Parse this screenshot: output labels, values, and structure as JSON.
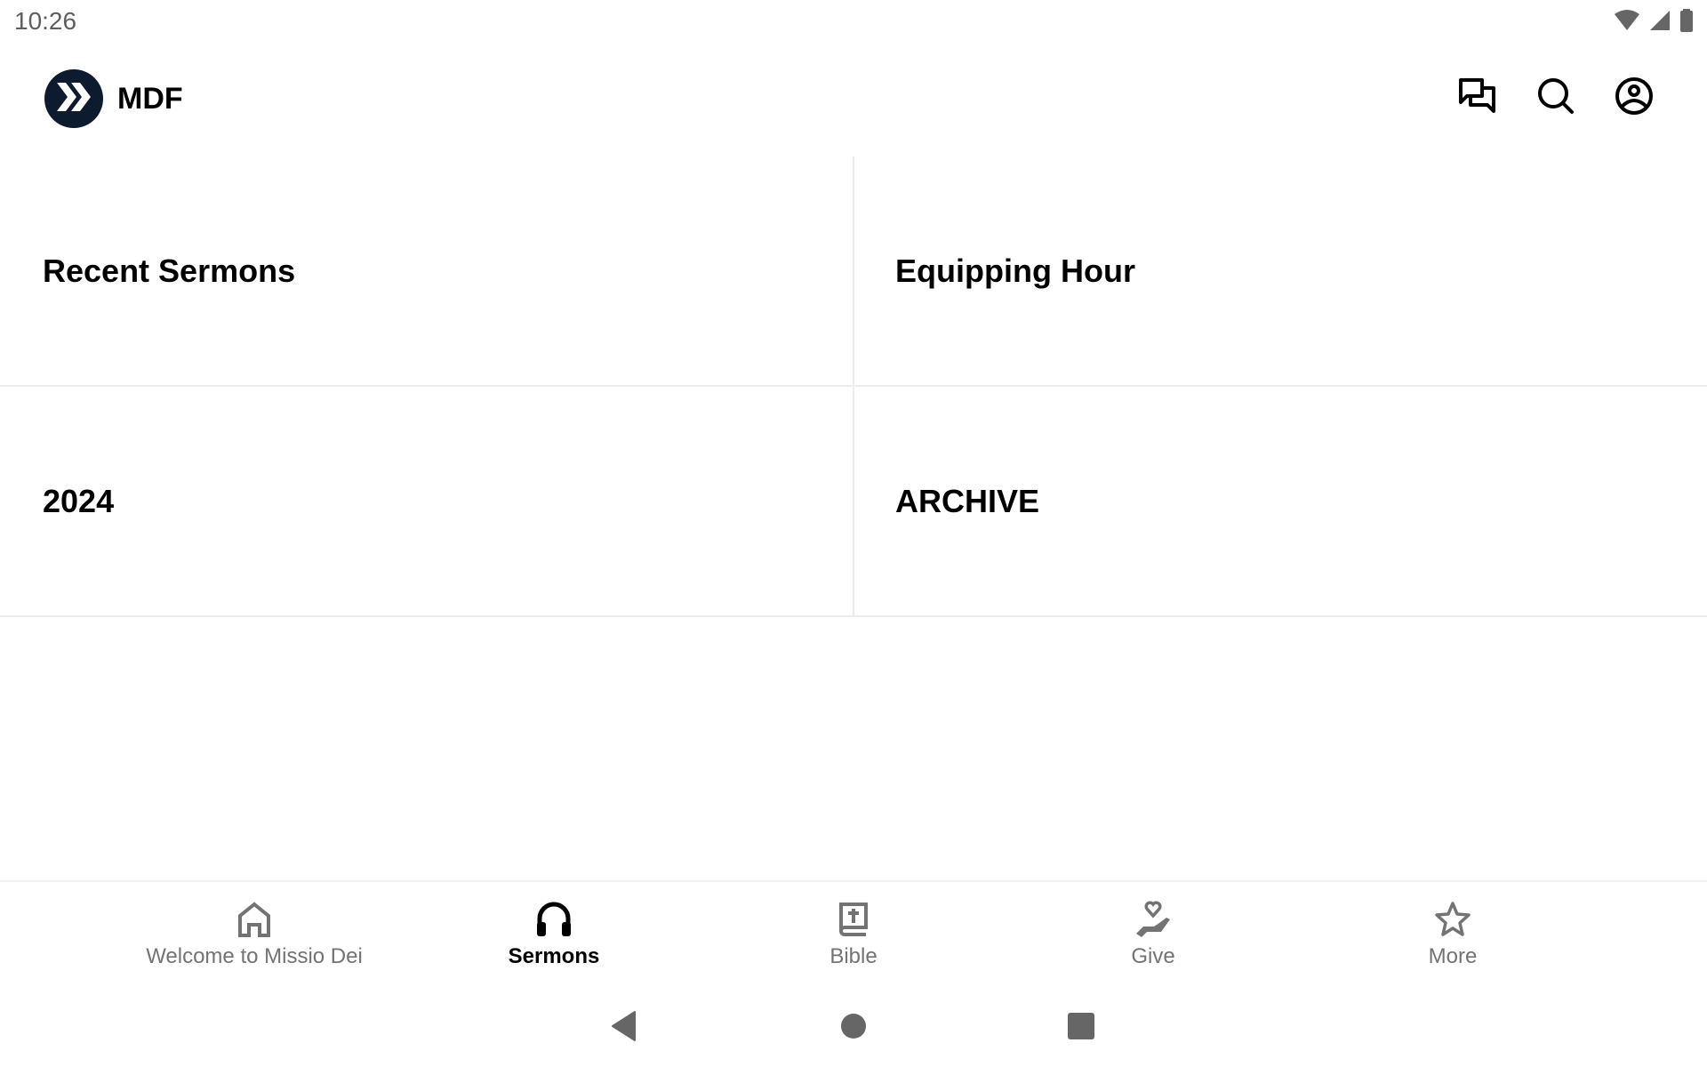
{
  "status_bar": {
    "time": "10:26",
    "icons": [
      "wifi-icon",
      "cellular-signal-icon",
      "battery-icon"
    ]
  },
  "app_bar": {
    "brand": "MDF",
    "logo_icon": "double-chevron-logo",
    "actions": [
      {
        "name": "chat",
        "icon": "chat-bubbles-icon"
      },
      {
        "name": "search",
        "icon": "search-icon"
      },
      {
        "name": "profile",
        "icon": "account-circle-icon"
      }
    ]
  },
  "tiles": [
    {
      "label": "Recent Sermons"
    },
    {
      "label": "Equipping Hour"
    },
    {
      "label": "2024"
    },
    {
      "label": "ARCHIVE"
    }
  ],
  "bottom_nav": {
    "active_index": 1,
    "items": [
      {
        "label": "Welcome to Missio Dei",
        "icon": "home-icon"
      },
      {
        "label": "Sermons",
        "icon": "headphones-icon"
      },
      {
        "label": "Bible",
        "icon": "bible-icon"
      },
      {
        "label": "Give",
        "icon": "give-hand-heart-icon"
      },
      {
        "label": "More",
        "icon": "star-icon"
      }
    ]
  },
  "system_nav": {
    "buttons": [
      "back",
      "home",
      "recents"
    ]
  },
  "colors": {
    "logo_bg": "#0d1b2e",
    "inactive": "#737373",
    "active": "#000000",
    "divider": "#ececec",
    "system_gray": "#666666"
  }
}
